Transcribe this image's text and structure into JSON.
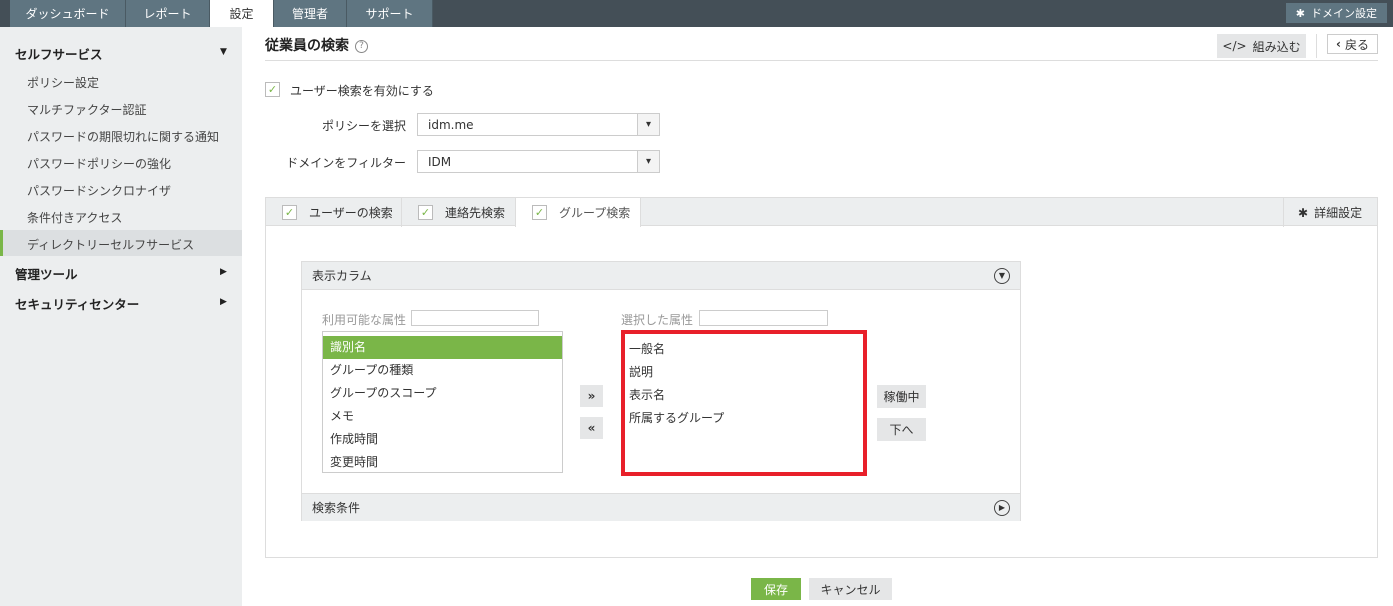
{
  "nav": {
    "tabs": [
      "ダッシュボード",
      "レポート",
      "設定",
      "管理者",
      "サポート"
    ],
    "active": 2,
    "domain_settings": "ドメイン設定"
  },
  "sidebar": {
    "self_service": "セルフサービス",
    "items": [
      "ポリシー設定",
      "マルチファクター認証",
      "パスワードの期限切れに関する通知",
      "パスワードポリシーの強化",
      "パスワードシンクロナイザ",
      "条件付きアクセス",
      "ディレクトリーセルフサービス"
    ],
    "admin_tools": "管理ツール",
    "security_center": "セキュリティセンター"
  },
  "header": {
    "title": "従業員の検索",
    "help": "?",
    "embed": "組み込む",
    "back": "戻る"
  },
  "form": {
    "enable_label": "ユーザー検索を有効にする",
    "policy_label": "ポリシーを選択",
    "policy_value": "idm.me",
    "domain_label": "ドメインをフィルター",
    "domain_value": "IDM"
  },
  "subtabs": {
    "items": [
      "ユーザーの検索",
      "連絡先検索",
      "グループ検索"
    ],
    "active": 2,
    "advanced": "詳細設定"
  },
  "columns": {
    "title": "表示カラム",
    "available_label": "利用可能な属性",
    "available": [
      "識別名",
      "グループの種類",
      "グループのスコープ",
      "メモ",
      "作成時間",
      "変更時間"
    ],
    "selected_label": "選択した属性",
    "selected": [
      "一般名",
      "説明",
      "表示名",
      "所属するグループ"
    ],
    "add": "»",
    "remove": "«",
    "up": "稼働中",
    "down": "下へ"
  },
  "criteria": {
    "title": "検索条件"
  },
  "footer": {
    "save": "保存",
    "cancel": "キャンセル"
  },
  "colors": {
    "accent": "#7ab648",
    "highlight": "#e8202a"
  }
}
